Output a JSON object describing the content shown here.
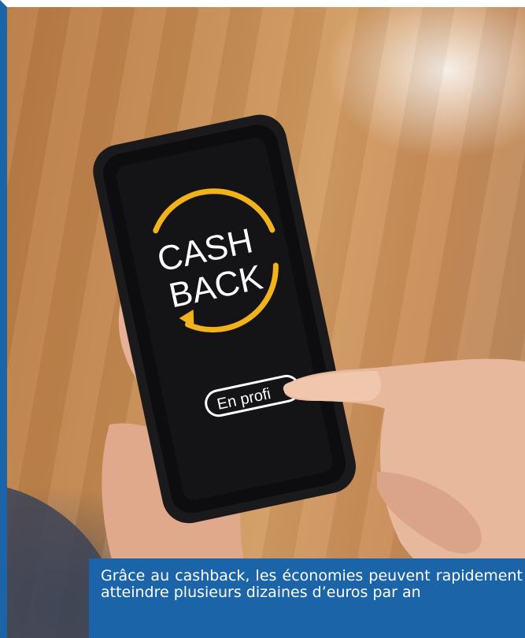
{
  "image": {
    "phone_screen": {
      "badge_line1": "CASH",
      "badge_line2": "BACK",
      "button_label": "En profi"
    },
    "colors": {
      "accent_ring": "#f2b21b",
      "caption_bg": "#1c64a8",
      "frame_border": "#1c64a8"
    }
  },
  "caption": {
    "text": "Grâce au cashback, les économies peuvent rapidement atteindre plusieurs dizaines d’euros par an"
  }
}
